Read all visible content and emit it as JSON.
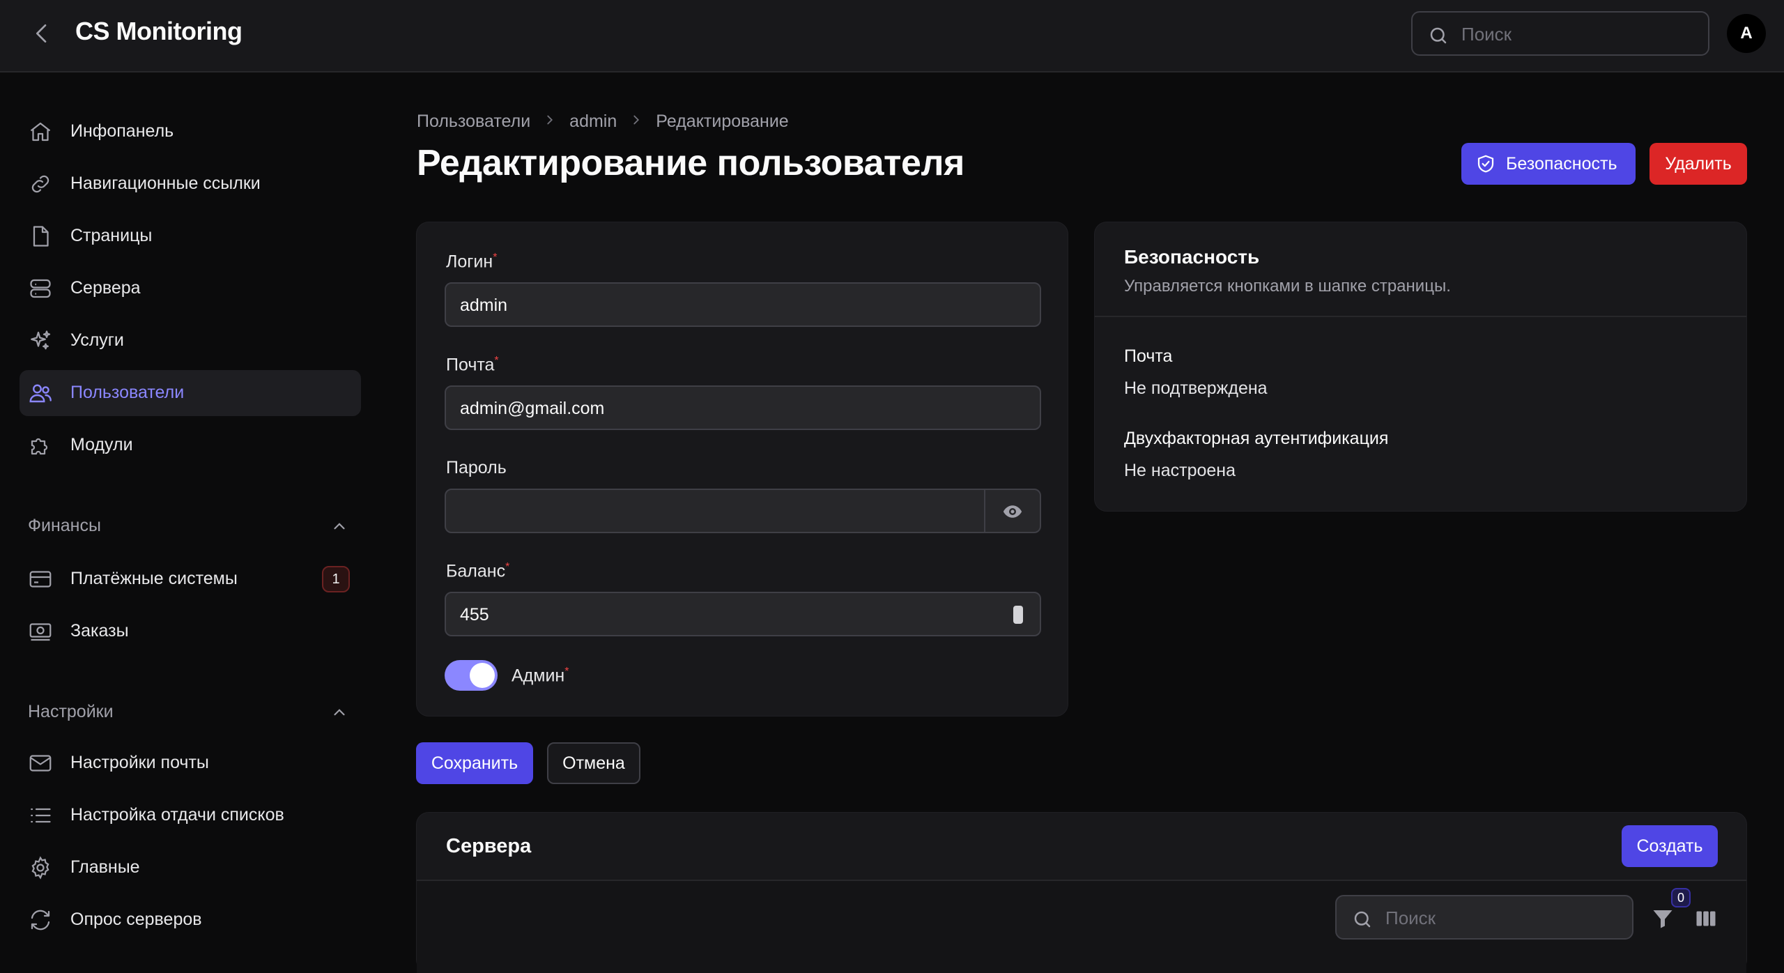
{
  "app": {
    "title": "CS Monitoring",
    "avatar_initial": "A"
  },
  "top_search": {
    "placeholder": "Поиск"
  },
  "sidebar": {
    "items": [
      {
        "label": "Инфопанель",
        "icon": "home-icon"
      },
      {
        "label": "Навигационные ссылки",
        "icon": "link-icon"
      },
      {
        "label": "Страницы",
        "icon": "document-icon"
      },
      {
        "label": "Сервера",
        "icon": "server-icon"
      },
      {
        "label": "Услуги",
        "icon": "sparkles-icon"
      },
      {
        "label": "Пользователи",
        "icon": "users-icon",
        "active": true
      },
      {
        "label": "Модули",
        "icon": "puzzle-icon"
      }
    ],
    "groups": [
      {
        "label": "Финансы",
        "items": [
          {
            "label": "Платёжные системы",
            "icon": "credit-card-icon",
            "badge": "1"
          },
          {
            "label": "Заказы",
            "icon": "banknotes-icon"
          }
        ]
      },
      {
        "label": "Настройки",
        "items": [
          {
            "label": "Настройки почты",
            "icon": "envelope-icon"
          },
          {
            "label": "Настройка отдачи списков",
            "icon": "list-icon"
          },
          {
            "label": "Главные",
            "icon": "cog-icon"
          },
          {
            "label": "Опрос серверов",
            "icon": "refresh-icon"
          }
        ]
      }
    ]
  },
  "breadcrumb": [
    "Пользователи",
    "admin",
    "Редактирование"
  ],
  "page": {
    "title": "Редактирование пользователя"
  },
  "header_actions": {
    "security": "Безопасность",
    "delete": "Удалить"
  },
  "form": {
    "login": {
      "label": "Логин",
      "value": "admin",
      "required": "*"
    },
    "email": {
      "label": "Почта",
      "value": "admin@gmail.com",
      "required": "*"
    },
    "password": {
      "label": "Пароль",
      "value": ""
    },
    "balance": {
      "label": "Баланс",
      "value": "455",
      "required": "*"
    },
    "admin": {
      "label": "Админ",
      "required": "*",
      "checked": true
    }
  },
  "security_card": {
    "title": "Безопасность",
    "subtitle": "Управляется кнопками в шапке страницы.",
    "email_label": "Почта",
    "email_value": "Не подтверждена",
    "twofa_label": "Двухфакторная аутентификация",
    "twofa_value": "Не настроена"
  },
  "form_actions": {
    "save": "Сохранить",
    "cancel": "Отмена"
  },
  "servers": {
    "title": "Сервера",
    "create": "Создать",
    "search_placeholder": "Поиск",
    "filter_count": "0"
  },
  "colors": {
    "accent": "#4f46e5",
    "active_text": "#8b87ff",
    "danger": "#dc2626"
  }
}
